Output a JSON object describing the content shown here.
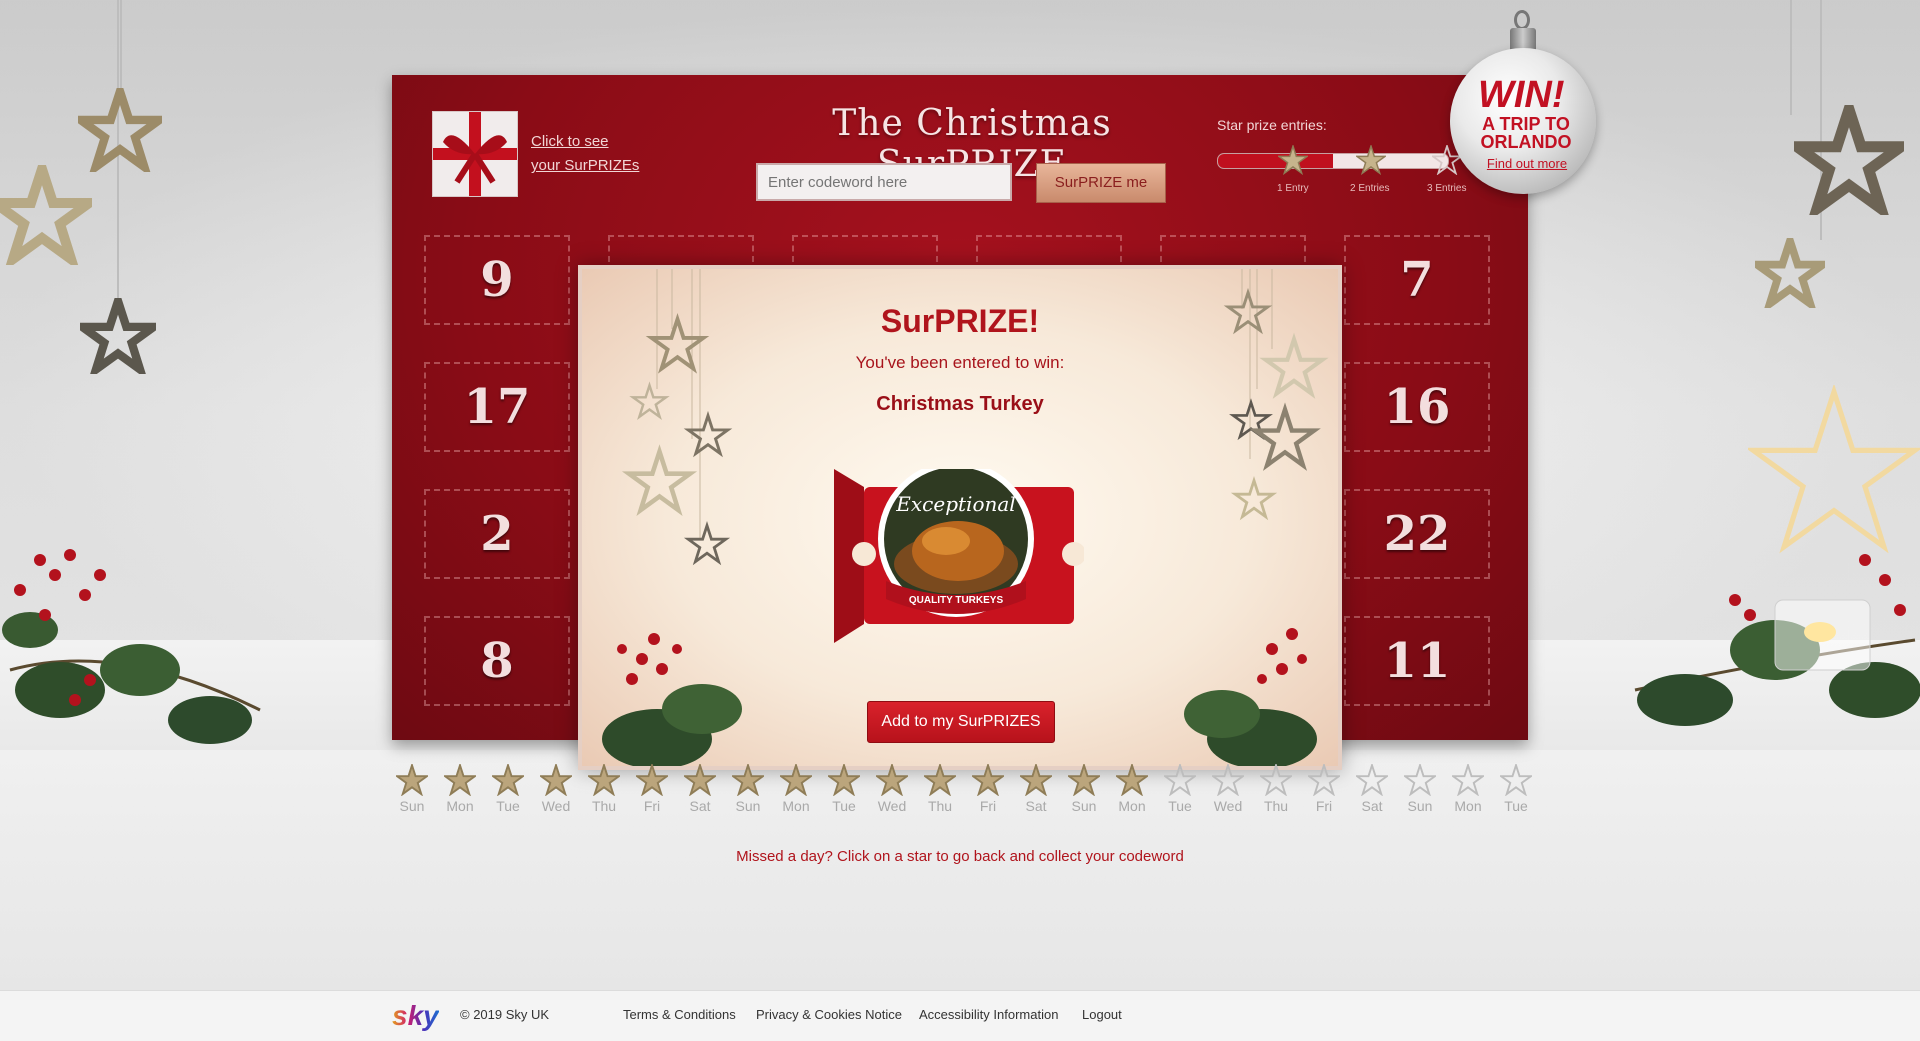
{
  "header": {
    "see_link_line1": "Click to see",
    "see_link_line2": "your SurPRIZEs",
    "title": "The Christmas SurPRIZE",
    "codeword_placeholder": "Enter codeword here",
    "surprize_button": "SurPRIZE me",
    "entries_label": "Star prize entries:",
    "entries_progress_fraction": 0.5,
    "entries": [
      "1 Entry",
      "2 Entries",
      "3 Entries"
    ]
  },
  "ornament": {
    "win": "WIN!",
    "line2": "A TRIP TO",
    "line3": "ORLANDO",
    "link": "Find out more"
  },
  "doors": [
    "9",
    "7",
    "17",
    "16",
    "2",
    "22",
    "8",
    "11"
  ],
  "modal": {
    "title": "SurPRIZE!",
    "subtitle": "You've been entered to win:",
    "prize": "Christmas Turkey",
    "ticket_text1": "Exceptional",
    "ticket_text2": "QUALITY TURKEYS",
    "add_button": "Add to my SurPRIZES"
  },
  "days": [
    {
      "label": "Sun",
      "active": true
    },
    {
      "label": "Mon",
      "active": true
    },
    {
      "label": "Tue",
      "active": true
    },
    {
      "label": "Wed",
      "active": true
    },
    {
      "label": "Thu",
      "active": true
    },
    {
      "label": "Fri",
      "active": true
    },
    {
      "label": "Sat",
      "active": true
    },
    {
      "label": "Sun",
      "active": true
    },
    {
      "label": "Mon",
      "active": true
    },
    {
      "label": "Tue",
      "active": true
    },
    {
      "label": "Wed",
      "active": true
    },
    {
      "label": "Thu",
      "active": true
    },
    {
      "label": "Fri",
      "active": true
    },
    {
      "label": "Sat",
      "active": true
    },
    {
      "label": "Sun",
      "active": true
    },
    {
      "label": "Mon",
      "active": true
    },
    {
      "label": "Tue",
      "active": false
    },
    {
      "label": "Wed",
      "active": false
    },
    {
      "label": "Thu",
      "active": false
    },
    {
      "label": "Fri",
      "active": false
    },
    {
      "label": "Sat",
      "active": false
    },
    {
      "label": "Sun",
      "active": false
    },
    {
      "label": "Mon",
      "active": false
    },
    {
      "label": "Tue",
      "active": false
    }
  ],
  "missed_text": "Missed a day? Click on a star to go back and collect your codeword",
  "footer": {
    "logo": "sky",
    "copyright": "© 2019 Sky UK",
    "links": [
      "Terms & Conditions",
      "Privacy & Cookies Notice",
      "Accessibility Information",
      "Logout"
    ]
  },
  "colors": {
    "calendar_red": "#8a0c16",
    "accent_red": "#b0141c",
    "gold_star": "#b8a27a"
  }
}
